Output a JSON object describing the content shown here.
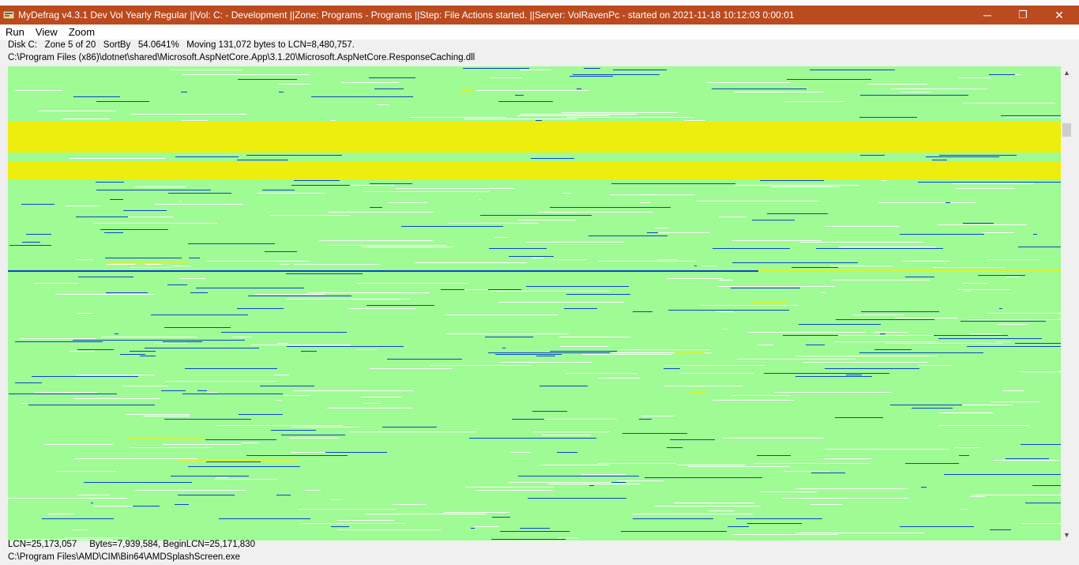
{
  "window": {
    "app_name": "MyDefrag v4.3.1",
    "title": "MyDefrag v4.3.1   Dev Vol Yearly Regular ||Vol: C: - Development ||Zone: Programs - Programs ||Step: File Actions started. ||Server: VolRavenPc -  started on 2021-11-18 10:12:03 0:00:01",
    "minimize_glyph": "─",
    "restore_glyph": "❐",
    "close_glyph": "✕"
  },
  "menu": {
    "items": [
      "Run",
      "View",
      "Zoom"
    ]
  },
  "status": {
    "line1": "Disk C:   Zone 5 of 20   SortBy   54.0641%   Moving 131,072 bytes to LCN=8,480,757.",
    "line2": "C:\\Program Files (x86)\\dotnet\\shared\\Microsoft.AspNetCore.App\\3.1.20\\Microsoft.AspNetCore.ResponseCaching.dll",
    "bottom_line1": "LCN=25,173,057     Bytes=7,939,584, BeginLCN=25,171,830",
    "bottom_line2": "C:\\Program Files\\AMD\\CIM\\Bin64\\AMDSplashScreen.exe"
  },
  "diskmap": {
    "colors": {
      "free_space": "#9ffb94",
      "busy_zone": "#eeee0e",
      "fragmented": "#0b45c9",
      "space_hole": "#ffffff"
    }
  },
  "scrollbar": {
    "up_glyph": "▲",
    "down_glyph": "▼"
  }
}
